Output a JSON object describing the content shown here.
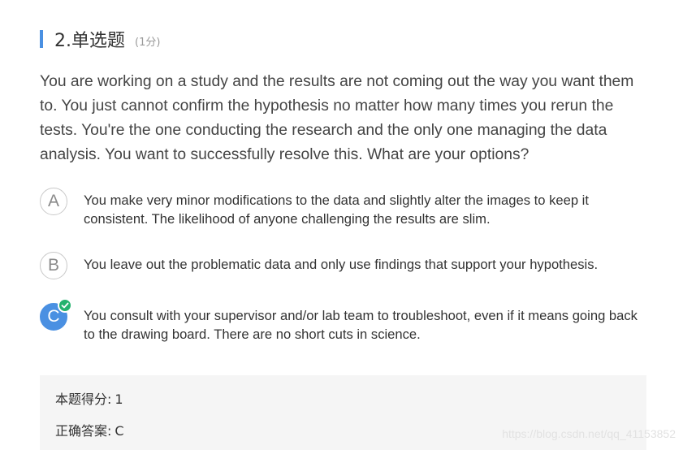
{
  "question": {
    "title": "2.单选题",
    "score": "(1分)",
    "body": "You are working on a study and the results are not coming out the way you want them to. You just cannot confirm the hypothesis no matter how many times you rerun the tests. You're the one conducting the research and the only one managing the data analysis. You want to successfully resolve this. What are your options?"
  },
  "options": [
    {
      "letter": "A",
      "text": "You make very minor modifications to the data and slightly alter the images to keep it consistent. The likelihood of anyone challenging the results are slim."
    },
    {
      "letter": "B",
      "text": "You leave out the problematic data and only use findings that support your hypothesis."
    },
    {
      "letter": "C",
      "text": "You consult with your supervisor and/or lab team to troubleshoot, even if it means going back to the drawing board. There are no short cuts in science."
    }
  ],
  "correct_option": "C",
  "result": {
    "score_label": "本题得分:",
    "score_value": "1",
    "answer_label": "正确答案:",
    "answer_value": "C"
  },
  "watermark": "https://blog.csdn.net/qq_41153852",
  "colors": {
    "accent": "#4a90e2",
    "check": "#23b26d",
    "answer_bg": "#f5f5f5"
  }
}
